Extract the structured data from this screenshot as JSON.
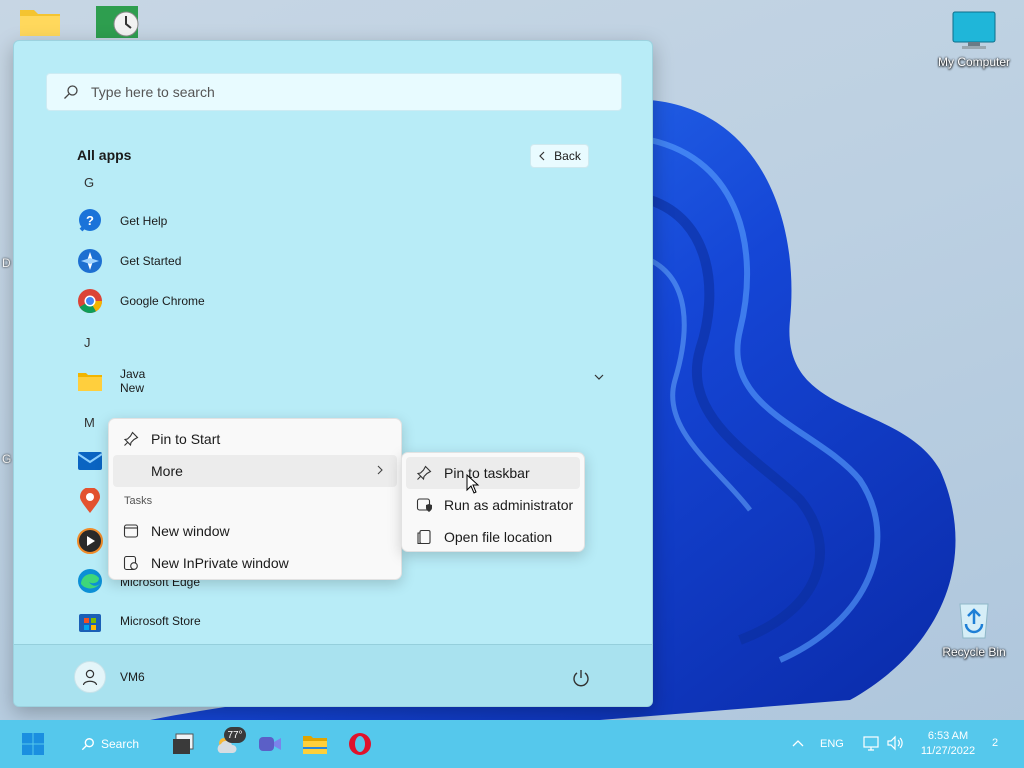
{
  "desktop": {
    "icons": [
      {
        "label": "My Computer",
        "icon": "monitor-icon"
      },
      {
        "label": "Recycle Bin",
        "icon": "recycle-bin-icon"
      }
    ],
    "edge_letters": [
      "D",
      "G"
    ]
  },
  "start_menu": {
    "search": {
      "placeholder": "Type here to search",
      "value": ""
    },
    "title": "All apps",
    "back_label": "Back",
    "groups": [
      {
        "letter": "G",
        "apps": [
          "Get Help",
          "Get Started",
          "Google Chrome"
        ]
      },
      {
        "letter": "J",
        "apps": [
          {
            "name": "Java",
            "sub": "New",
            "expandable": true
          }
        ]
      },
      {
        "letter": "M",
        "apps": [
          "Microsoft Edge",
          "Microsoft Store"
        ]
      }
    ],
    "letters": {
      "g": "G",
      "j": "J",
      "m": "M"
    },
    "apps": {
      "get_help": "Get Help",
      "get_started": "Get Started",
      "chrome": "Google Chrome",
      "java": "Java",
      "java_sub": "New",
      "edge": "Microsoft Edge",
      "store": "Microsoft Store"
    },
    "user": {
      "name": "VM6"
    }
  },
  "context_menu": {
    "pin_to_start": "Pin to Start",
    "more": "More",
    "tasks_header": "Tasks",
    "new_window": "New window",
    "new_inprivate": "New InPrivate window"
  },
  "submenu": {
    "pin_to_taskbar": "Pin to taskbar",
    "run_as_admin": "Run as administrator",
    "open_file_location": "Open file location"
  },
  "taskbar": {
    "search_label": "Search",
    "weather_temp": "77°",
    "language": "ENG",
    "time": "6:53 AM",
    "date": "11/27/2022",
    "notification_count": "2"
  },
  "colors": {
    "start_bg": "#b8ecf7",
    "taskbar_bg": "#55c8ec",
    "wallpaper_blue": "#1f5ee8"
  }
}
